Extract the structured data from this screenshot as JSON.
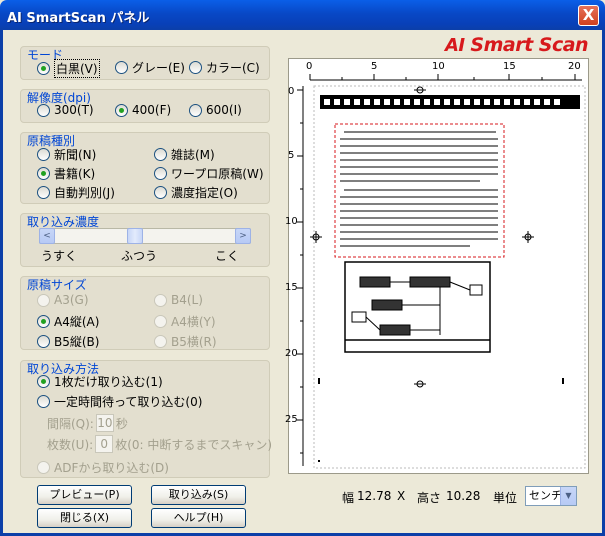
{
  "window": {
    "title": "AI SmartScan パネル",
    "close_label": "X"
  },
  "logo": {
    "part1": "AI ",
    "part2": "Smart Scan"
  },
  "mode": {
    "title": "モード",
    "options": [
      {
        "label": "白黒(V)",
        "checked": true
      },
      {
        "label": "グレー(E)",
        "checked": false
      },
      {
        "label": "カラー(C)",
        "checked": false
      }
    ]
  },
  "resolution": {
    "title": "解像度(dpi)",
    "options": [
      {
        "label": "300(T)",
        "checked": false
      },
      {
        "label": "400(F)",
        "checked": true
      },
      {
        "label": "600(I)",
        "checked": false
      }
    ]
  },
  "doc_type": {
    "title": "原稿種別",
    "options": [
      {
        "label": "新聞(N)",
        "checked": false
      },
      {
        "label": "雑誌(M)",
        "checked": false
      },
      {
        "label": "書籍(K)",
        "checked": true
      },
      {
        "label": "ワープロ原稿(W)",
        "checked": false
      },
      {
        "label": "自動判別(J)",
        "checked": false
      },
      {
        "label": "濃度指定(O)",
        "checked": false
      }
    ]
  },
  "density": {
    "title": "取り込み濃度",
    "left_arrow": "<",
    "right_arrow": ">",
    "labels": [
      "うすく",
      "ふつう",
      "こく"
    ]
  },
  "doc_size": {
    "title": "原稿サイズ",
    "options": [
      {
        "label": "A3(G)",
        "checked": false,
        "disabled": true
      },
      {
        "label": "B4(L)",
        "checked": false,
        "disabled": true
      },
      {
        "label": "A4縦(A)",
        "checked": true,
        "disabled": false
      },
      {
        "label": "A4横(Y)",
        "checked": false,
        "disabled": true
      },
      {
        "label": "B5縦(B)",
        "checked": false,
        "disabled": false
      },
      {
        "label": "B5横(R)",
        "checked": false,
        "disabled": true
      }
    ]
  },
  "capture_method": {
    "title": "取り込み方法",
    "option_once": "1枚だけ取り込む(1)",
    "option_interval": "一定時間待って取り込む(0)",
    "interval_label": "間隔(Q):",
    "interval_value": "10",
    "interval_unit": "秒",
    "count_label": "枚数(U):",
    "count_value": "0",
    "count_unit": "枚(0: 中断するまでスキャン)",
    "adf_label": "ADFから取り込む(D)"
  },
  "buttons": {
    "preview": "プレビュー(P)",
    "capture": "取り込み(S)",
    "close": "閉じる(X)",
    "help": "ヘルプ(H)"
  },
  "ruler": {
    "h_labels": [
      "0",
      "5",
      "10",
      "15",
      "20"
    ],
    "v_labels": [
      "0",
      "5",
      "10",
      "15",
      "20",
      "25"
    ]
  },
  "dimensions": {
    "width_label": "幅",
    "width_value": "12.78",
    "separator": "X",
    "height_label": "高さ",
    "height_value": "10.28",
    "unit_label": "単位",
    "unit_value": "センチ"
  }
}
